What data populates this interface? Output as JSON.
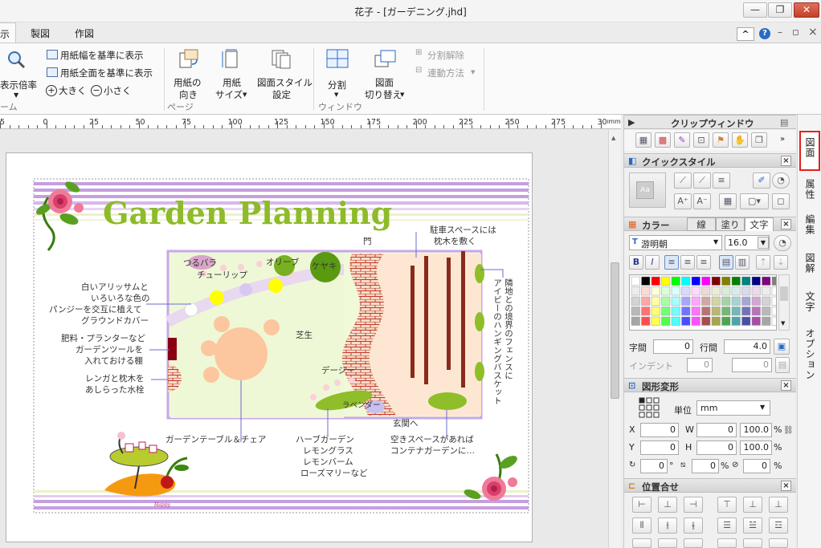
{
  "window": {
    "title": "花子 - [ガーデニング.jhd]",
    "min": "—",
    "restore": "❐",
    "close": "✕"
  },
  "tabs": [
    {
      "label": "示"
    },
    {
      "label": "製図"
    },
    {
      "label": "作図"
    }
  ],
  "ribbon_right": {
    "collapse": "^",
    "help": "?",
    "min": "–",
    "restore": "▫",
    "close": "×"
  },
  "ribbon": {
    "zoom_label": "表示倍率",
    "fit_width": "用紙幅を基準に表示",
    "fit_all": "用紙全面を基準に表示",
    "bigger": "大きく",
    "smaller": "小さく",
    "zoom_group": "ーム",
    "orientation": [
      "用紙の",
      "向き"
    ],
    "paper_size": [
      "用紙",
      "サイズ"
    ],
    "drawing_style": [
      "図面スタイル",
      "設定"
    ],
    "page_group": "ページ",
    "split": "分割",
    "switch": [
      "図面",
      "切り替え"
    ],
    "window_group": "ウィンドウ",
    "unsplit": "分割解除",
    "link_method": "連動方法"
  },
  "ruler": {
    "unit": "mm",
    "labels": [
      "5",
      "0",
      "25",
      "50",
      "75",
      "100",
      "125",
      "150",
      "175",
      "200",
      "225",
      "250",
      "275",
      "300"
    ]
  },
  "clip": {
    "title": "クリップウィンドウ"
  },
  "quickstyle": {
    "title": "クイックスタイル"
  },
  "color": {
    "title": "カラー",
    "tab_line": "線",
    "tab_fill": "塗り",
    "tab_text": "文字",
    "font": "游明朝",
    "size": "16.0",
    "char_spacing_label": "字間",
    "char_spacing": "0",
    "line_spacing_label": "行間",
    "line_spacing": "4.0",
    "indent_label": "インデント",
    "indent": "0",
    "indent2": "0",
    "palette": [
      "#000000",
      "#ff0000",
      "#ffff00",
      "#00ff00",
      "#00ffff",
      "#0000ff",
      "#ff00ff",
      "#800000",
      "#808000",
      "#008000",
      "#008080",
      "#000080",
      "#800080",
      "#808080"
    ]
  },
  "transform": {
    "title": "図形変形",
    "unit_label": "単位",
    "unit": "mm",
    "x_label": "X",
    "x": "0",
    "w_label": "W",
    "w": "0",
    "w_pct": "100.0",
    "y_label": "Y",
    "y": "0",
    "h_label": "H",
    "h": "0",
    "h_pct": "100.0",
    "rot": "0",
    "rot_unit": "°",
    "skew": "0",
    "skew_unit": "%",
    "extra": "0",
    "extra_unit": "%",
    "pct": "%"
  },
  "align": {
    "title": "位置合せ"
  },
  "side_tabs": [
    "図面",
    "属性",
    "編集",
    "図解",
    "文字",
    "オプション"
  ],
  "garden": {
    "title": "Garden Planning",
    "labels": {
      "tsurubara": "つるバラ",
      "tulip": "チューリップ",
      "olive": "オリーブ",
      "keyaki": "ケヤキ",
      "gate": "門",
      "parking1": "駐車スペースには",
      "parking2": "枕木を敷く",
      "alyssum": [
        "白いアリッサムと",
        "いろいろな色の",
        "パンジーを交互に植えて",
        "グラウンドカバー"
      ],
      "shelf": [
        "肥料・プランターなど",
        "ガーデンツールを",
        "入れておける棚"
      ],
      "faucet": [
        "レンガと枕木を",
        "あしらった水栓"
      ],
      "lawn": "芝生",
      "daisy": "デージー",
      "lavender": "ラベンダー",
      "fence": [
        "隣地との境界のフェンスに",
        "アイビーのハンギングバスケット"
      ],
      "entrance": "玄関へ",
      "table": "ガーデンテーブル＆チェア",
      "herb": [
        "ハーブガーデン",
        "レモングラス",
        "レモンバーム",
        "ローズマリーなど"
      ],
      "container": [
        "空きスペースがあれば",
        "コンテナガーデンに…"
      ]
    },
    "sign": "Happy"
  }
}
